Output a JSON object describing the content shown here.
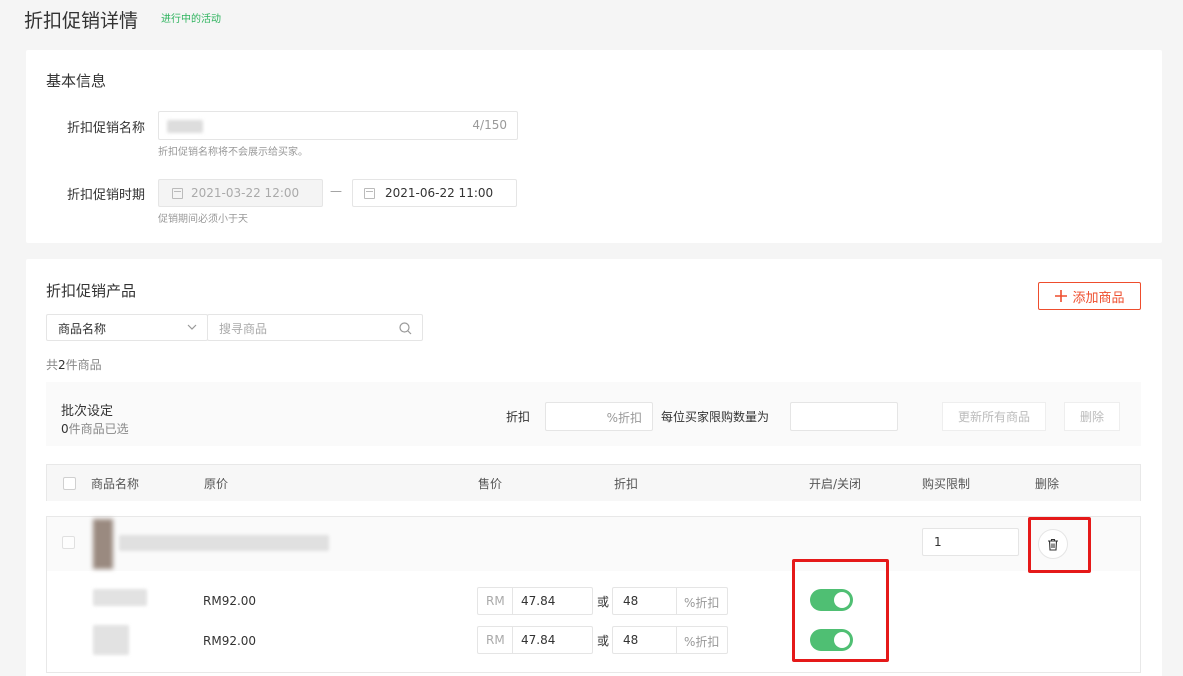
{
  "header": {
    "title": "折扣促销详情",
    "status": "进行中的活动"
  },
  "basic_info": {
    "section_title": "基本信息",
    "name_label": "折扣促销名称",
    "name_counter": "4/150",
    "name_hint": "折扣促销名称将不会展示给买家。",
    "period_label": "折扣促销时期",
    "start_date": "2021-03-22 12:00",
    "date_separator": "—",
    "end_date": "2021-06-22 11:00",
    "period_hint": "促销期间必须小于天"
  },
  "products": {
    "section_title": "折扣促销产品",
    "add_button": "添加商品",
    "add_icon": "plus-icon",
    "filter_select": "商品名称",
    "search_placeholder": "搜寻商品",
    "count_prefix": "共",
    "count_value": "2",
    "count_suffix": "件商品",
    "batch": {
      "title": "批次设定",
      "selected_count": "0",
      "selected_suffix": "件商品已选",
      "discount_label": "折扣",
      "discount_suffix": "%折扣",
      "limit_label": "每位买家限购数量为",
      "update_all_button": "更新所有商品",
      "delete_button": "删除"
    },
    "columns": [
      "商品名称",
      "原价",
      "售价",
      "折扣",
      "开启/关闭",
      "购买限制",
      "删除"
    ],
    "purchase_limit_value": "1",
    "variants": [
      {
        "original_price": "RM92.00",
        "currency": "RM",
        "sale_price": "47.84",
        "or_text": "或",
        "discount": "48",
        "discount_suffix": "%折扣",
        "enabled": true
      },
      {
        "original_price": "RM92.00",
        "currency": "RM",
        "sale_price": "47.84",
        "or_text": "或",
        "discount": "48",
        "discount_suffix": "%折扣",
        "enabled": true
      }
    ]
  },
  "colors": {
    "brand": "#ee4d2d",
    "status_green": "#2db35d",
    "toggle_on": "#4fbf73",
    "highlight_frame": "#e51919"
  }
}
